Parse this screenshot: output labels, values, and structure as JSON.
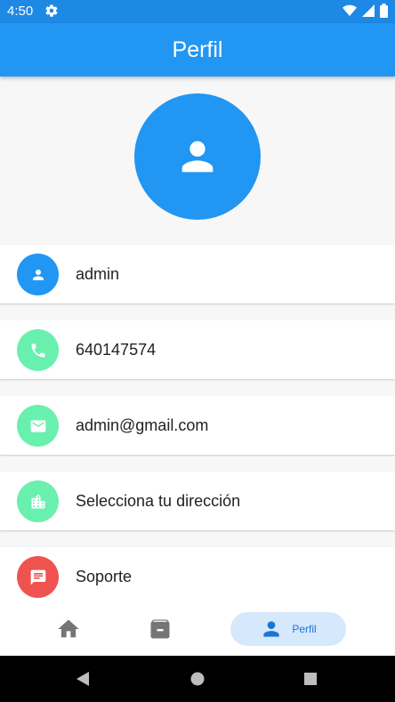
{
  "status_bar": {
    "time": "4:50"
  },
  "app_bar": {
    "title": "Perfil"
  },
  "profile_items": [
    {
      "label": "admin",
      "icon": "person-icon",
      "color": "#2196f3"
    },
    {
      "label": "640147574",
      "icon": "phone-icon",
      "color": "#69f0ae"
    },
    {
      "label": "admin@gmail.com",
      "icon": "email-icon",
      "color": "#69f0ae"
    },
    {
      "label": "Selecciona tu dirección",
      "icon": "location-city-icon",
      "color": "#69f0ae"
    },
    {
      "label": "Soporte",
      "icon": "chat-icon",
      "color": "#ef5350"
    }
  ],
  "bottom_nav": {
    "home": "home-icon",
    "archive": "archive-icon",
    "profile_label": "Perfil"
  },
  "colors": {
    "primary": "#2196f3",
    "status_bar": "#1e88e5",
    "nav_active_bg": "#d6e8fb"
  }
}
